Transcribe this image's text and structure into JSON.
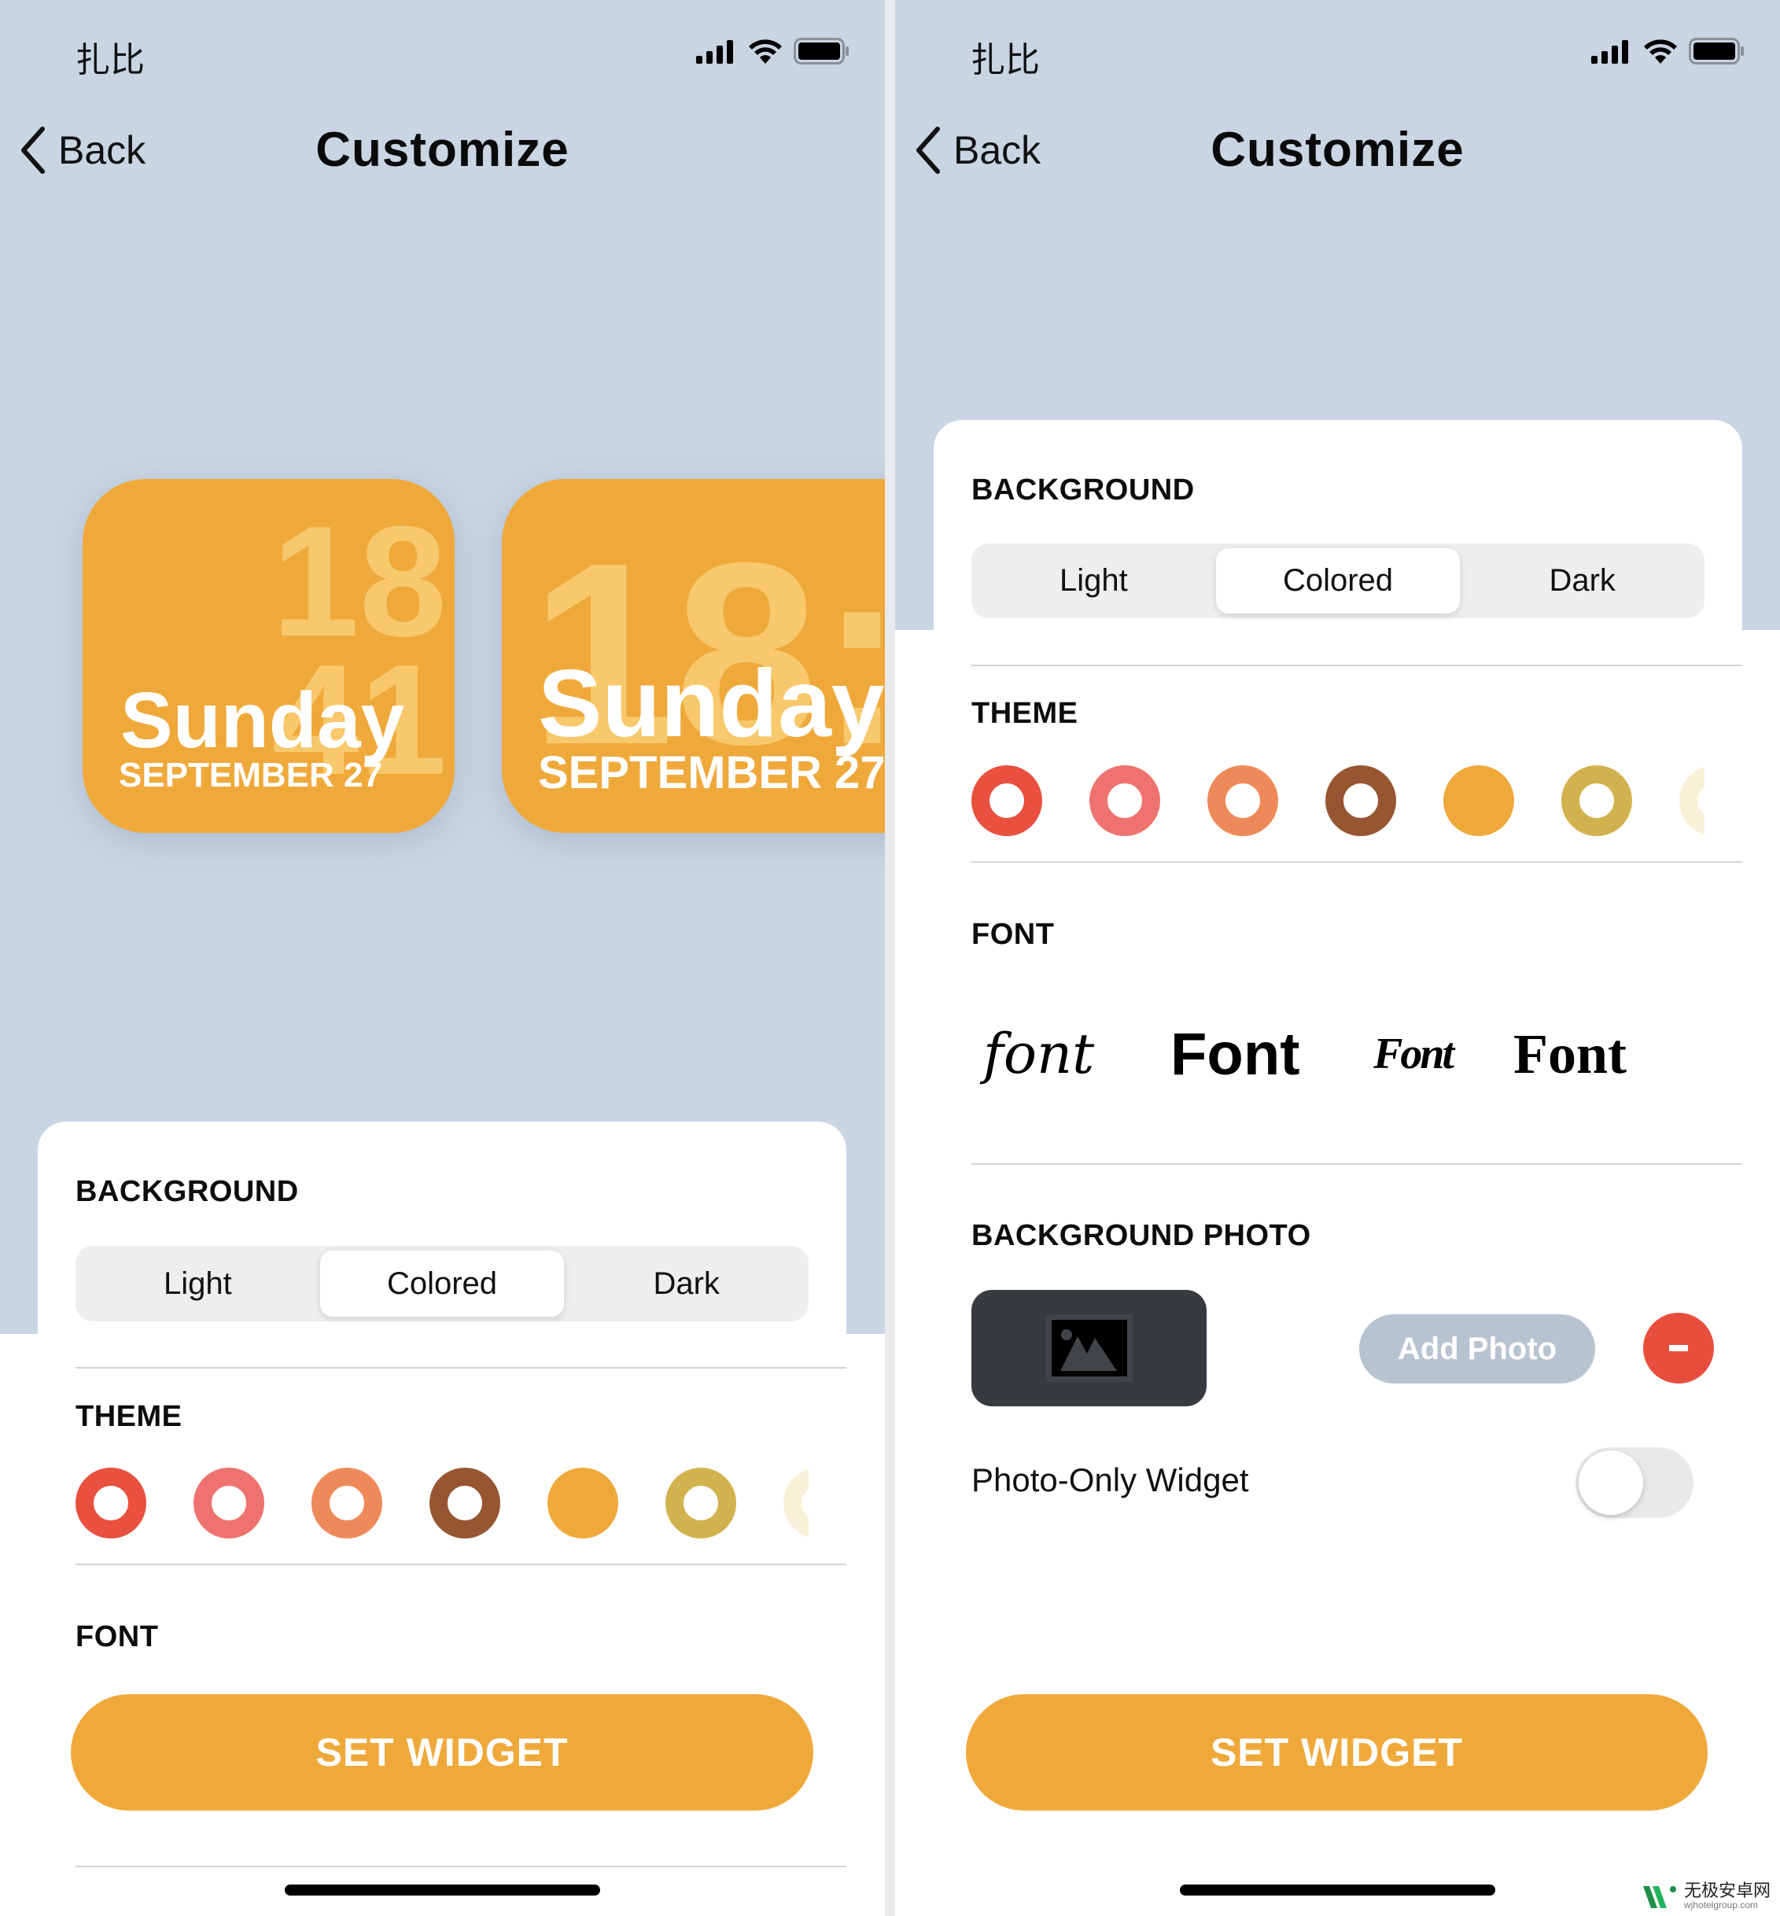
{
  "status_bar": {
    "carrier": "扎比",
    "icons": [
      "cellular-signal-icon",
      "wifi-icon",
      "battery-icon"
    ]
  },
  "nav": {
    "back_label": "Back",
    "title": "Customize"
  },
  "widget_preview": {
    "hour": "18",
    "minute": "41",
    "medium_time": "18:",
    "day": "Sunday",
    "date": "SEPTEMBER 27"
  },
  "background": {
    "label": "BACKGROUND",
    "options": [
      "Light",
      "Colored",
      "Dark"
    ],
    "selected": "Colored"
  },
  "theme": {
    "label": "THEME",
    "swatches": [
      {
        "name": "red",
        "color": "#e9503f",
        "selected": false
      },
      {
        "name": "pink",
        "color": "#ee7370",
        "selected": false
      },
      {
        "name": "coral",
        "color": "#ee8a5a",
        "selected": false
      },
      {
        "name": "brown",
        "color": "#975632",
        "selected": false
      },
      {
        "name": "orange",
        "color": "#efa93b",
        "selected": true
      },
      {
        "name": "mustard",
        "color": "#d2b24e",
        "selected": false
      },
      {
        "name": "cream",
        "color": "#f8f1d8",
        "selected": false
      }
    ]
  },
  "font": {
    "label": "FONT",
    "options": [
      {
        "name": "script",
        "sample": "font"
      },
      {
        "name": "sans-bold",
        "sample": "Font"
      },
      {
        "name": "brush",
        "sample": "Font"
      },
      {
        "name": "serif",
        "sample": "Font"
      }
    ]
  },
  "background_photo": {
    "label": "BACKGROUND PHOTO",
    "add_photo_label": "Add Photo",
    "remove_label": "-",
    "photo_only_label": "Photo-Only Widget",
    "photo_only_enabled": false
  },
  "set_widget_label": "SET WIDGET",
  "colors": {
    "accent": "#efa93b",
    "sky": "#c9d5e3",
    "destructive": "#e84e3e"
  },
  "watermark": {
    "site_cn": "无极安卓网",
    "site_url": "wjhotelgroup.com"
  }
}
